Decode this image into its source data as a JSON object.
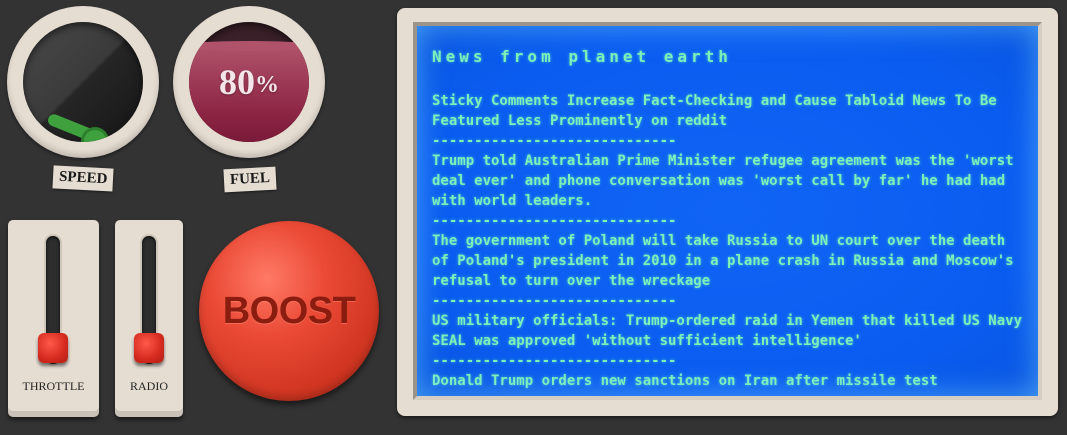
{
  "gauges": {
    "speed": {
      "label": "SPEED"
    },
    "fuel": {
      "label": "FUEL",
      "value": "80",
      "unit": "%",
      "level": 0.8
    }
  },
  "sliders": [
    {
      "label": "THROTTLE"
    },
    {
      "label": "RADIO"
    }
  ],
  "boost": {
    "label": "BOOST"
  },
  "colors": {
    "background": "#333333",
    "panel": "#e6ddd2",
    "screen": "#0a5cf0",
    "text": "#7ff0b8",
    "boost": "#d13622",
    "fuel": "#8c2544",
    "needle": "#3ea13e"
  },
  "news": {
    "title": "News from planet earth",
    "separator": "-----------------------------",
    "items": [
      "Sticky Comments Increase Fact-Checking and Cause Tabloid News To Be Featured Less Prominently on reddit",
      "Trump told Australian Prime Minister refugee agreement was the 'worst deal ever' and phone conversation was 'worst call by far' he had had with world leaders.",
      "The government of Poland will take Russia to UN court over the death of Poland's president in 2010 in a plane crash in Russia and Moscow's refusal to turn over the wreckage",
      "US military officials: Trump-ordered raid in Yemen that killed US Navy SEAL was approved 'without sufficient intelligence'",
      "Donald Trump orders new sanctions on Iran after missile test"
    ]
  }
}
